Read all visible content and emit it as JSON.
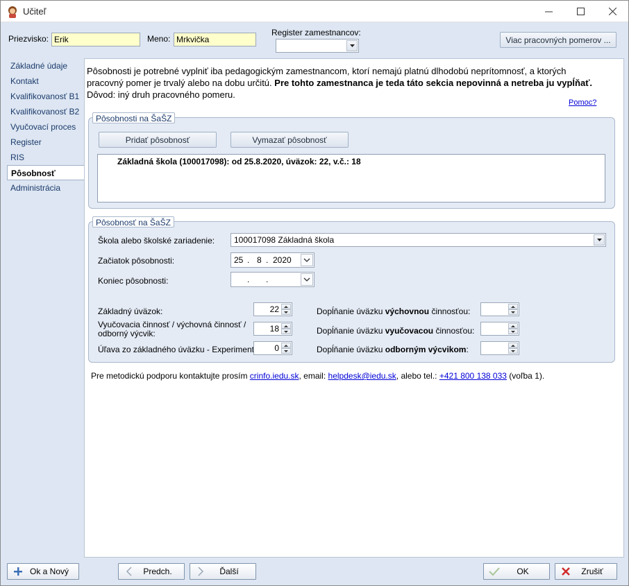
{
  "window": {
    "title": "Učiteľ",
    "icon": "teacher-avatar-icon"
  },
  "header": {
    "surname_label": "Priezvisko:",
    "surname_value": "Erik",
    "name_label": "Meno:",
    "name_value": "Mrkvička",
    "register_label": "Register zamestnancov:",
    "register_value": "",
    "more_contracts_button": "Viac pracovných pomerov ..."
  },
  "sidebar": {
    "items": [
      {
        "label": "Základné údaje"
      },
      {
        "label": "Kontakt"
      },
      {
        "label": "Kvalifikovanosť B1"
      },
      {
        "label": "Kvalifikovanosť B2"
      },
      {
        "label": "Vyučovací proces"
      },
      {
        "label": "Register"
      },
      {
        "label": "RIS"
      },
      {
        "label": "Pôsobnosť"
      },
      {
        "label": "Administrácia"
      }
    ],
    "active_index": 7
  },
  "main": {
    "intro_normal_1": "Pôsobnosti je potrebné vyplniť iba pedagogickým zamestnancom, ktorí nemajú platnú dlhodobú neprítomnosť, a ktorých pracovný pomer je trvalý alebo na dobu určitú.",
    "intro_bold": "Pre tohto zamestnanca je teda táto sekcia nepovinná a netreba ju vypĺňať.",
    "intro_normal_2": "Dôvod: iný druh pracovného pomeru.",
    "help_link": "Pomoc?",
    "group1": {
      "title": "Pôsobnosti na ŠaŠZ",
      "add_button": "Pridať pôsobnosť",
      "delete_button": "Vymazať pôsobnosť",
      "list_items": [
        "Základná škola (100017098): od 25.8.2020, úväzok: 22, v.č.: 18"
      ]
    },
    "group2": {
      "title": "Pôsobnosť na ŠaŠZ",
      "school_label": "Škola alebo školské zariadenie:",
      "school_value": "100017098 Základná škola",
      "start_label": "Začiatok pôsobnosti:",
      "start_day": "25",
      "start_month": "8",
      "start_year": "2020",
      "end_label": "Koniec pôsobnosti:",
      "basic_load_label": "Základný úväzok:",
      "basic_load_value": "22",
      "teaching_label_1": "Vyučovacia činnosť / výchovná činnosť /",
      "teaching_label_2": "odborný výcvik:",
      "teaching_value": "18",
      "relief_label": "Úľava zo základného úväzku - Experiment:",
      "relief_value": "0",
      "fill_prefix": "Dopĺňanie úväzku",
      "fill1_bold": "výchovnou",
      "fill1_suffix": "činnosťou:",
      "fill1_value": "",
      "fill2_bold": "vyučovacou",
      "fill2_suffix": "činnosťou:",
      "fill2_value": "",
      "fill3_bold": "odborným výcvikom",
      "fill3_suffix": ":",
      "fill3_value": ""
    },
    "contact": {
      "prefix": "Pre metodickú podporu kontaktujte prosím",
      "link1": "crinfo.iedu.sk",
      "middle1": ", email:",
      "link2": "helpdesk@iedu.sk",
      "middle2": ", alebo tel.:",
      "link3": "+421 800 138 033",
      "suffix": "(voľba 1)."
    }
  },
  "footer": {
    "ok_new": "Ok a Nový",
    "prev": "Predch.",
    "next": "Ďalší",
    "ok": "OK",
    "cancel": "Zrušiť"
  }
}
